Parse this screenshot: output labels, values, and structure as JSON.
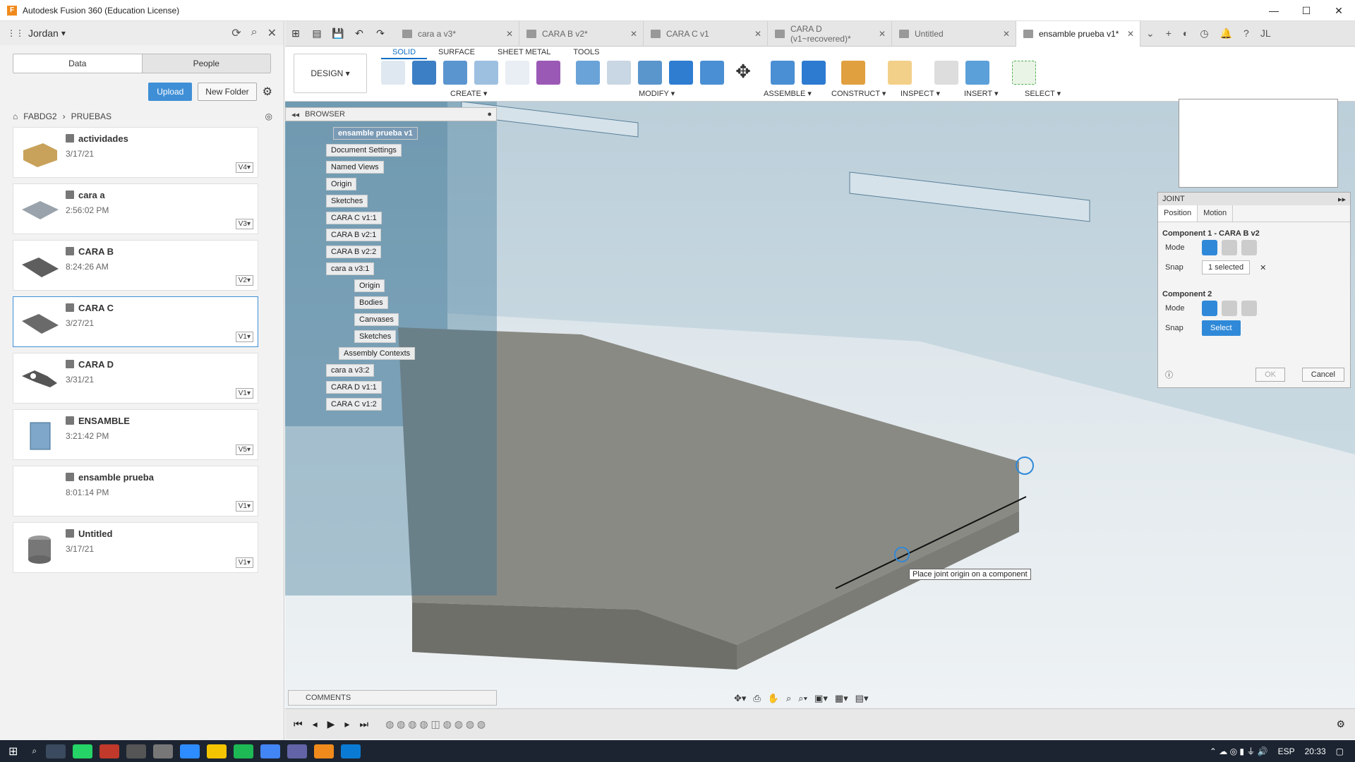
{
  "window": {
    "title": "Autodesk Fusion 360 (Education License)",
    "logo": "F"
  },
  "left": {
    "user": "Jordan",
    "tab_data": "Data",
    "tab_people": "People",
    "upload": "Upload",
    "new_folder": "New Folder",
    "crumb1": "FABDG2",
    "crumb2": "PRUEBAS",
    "files": [
      {
        "name": "actividades",
        "date": "3/17/21",
        "ver": "V4▾"
      },
      {
        "name": "cara a",
        "date": "2:56:02 PM",
        "ver": "V3▾"
      },
      {
        "name": "CARA B",
        "date": "8:24:26 AM",
        "ver": "V2▾"
      },
      {
        "name": "CARA C",
        "date": "3/27/21",
        "ver": "V1▾"
      },
      {
        "name": "CARA D",
        "date": "3/31/21",
        "ver": "V1▾"
      },
      {
        "name": "ENSAMBLE",
        "date": "3:21:42 PM",
        "ver": "V5▾"
      },
      {
        "name": "ensamble prueba",
        "date": "8:01:14 PM",
        "ver": "V1▾"
      },
      {
        "name": "Untitled",
        "date": "3/17/21",
        "ver": "V1▾"
      }
    ]
  },
  "tabs": [
    "cara a v3*",
    "CARA B v2*",
    "CARA C v1",
    "CARA D (v1~recovered)*",
    "Untitled",
    "ensamble prueba v1*"
  ],
  "ribbon": {
    "design": "DESIGN ▾",
    "tabs": [
      "SOLID",
      "SURFACE",
      "SHEET METAL",
      "TOOLS"
    ],
    "groups": [
      "CREATE ▾",
      "MODIFY ▾",
      "ASSEMBLE ▾",
      "CONSTRUCT ▾",
      "INSPECT ▾",
      "INSERT ▾",
      "SELECT ▾"
    ]
  },
  "browser": {
    "title": "BROWSER",
    "nodes": [
      "ensamble prueba v1",
      "Document Settings",
      "Named Views",
      "Origin",
      "Sketches",
      "CARA C v1:1",
      "CARA B v2:1",
      "CARA B v2:2",
      "cara a v3:1",
      "Origin",
      "Bodies",
      "Canvases",
      "Sketches",
      "Assembly Contexts",
      "cara a v3:2",
      "CARA D v1:1",
      "CARA C v1:2"
    ]
  },
  "joint": {
    "title": "JOINT",
    "tab_position": "Position",
    "tab_motion": "Motion",
    "comp1": "Component 1 - CARA B v2",
    "comp2": "Component 2",
    "mode": "Mode",
    "snap": "Snap",
    "selected": "1 selected",
    "select": "Select",
    "ok": "OK",
    "cancel": "Cancel"
  },
  "tooltip": "Place joint origin on a component",
  "comments": "COMMENTS",
  "taskbar": {
    "lang": "ESP",
    "time": "20:33"
  },
  "colors": {
    "accent": "#2f89d8",
    "tree_root": "#7a9ab5"
  }
}
